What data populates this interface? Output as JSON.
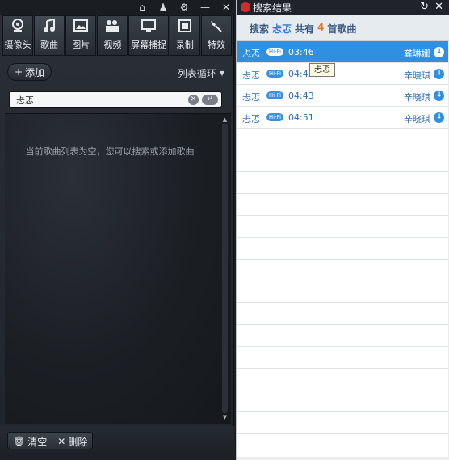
{
  "left": {
    "tabs": [
      {
        "label": "摄像头",
        "icon": "webcam-icon"
      },
      {
        "label": "歌曲",
        "icon": "music-note-icon"
      },
      {
        "label": "图片",
        "icon": "image-icon"
      },
      {
        "label": "视频",
        "icon": "video-icon"
      },
      {
        "label": "屏幕捕捉",
        "icon": "screen-capture-icon"
      },
      {
        "label": "录制",
        "icon": "record-icon"
      },
      {
        "label": "特效",
        "icon": "magic-wand-icon"
      }
    ],
    "add_label": "添加",
    "loop_mode": "列表循环",
    "search_value": "忐忑",
    "empty_message": "当前歌曲列表为空，您可以搜索或添加歌曲",
    "clear_label": "清空",
    "delete_label": "删除"
  },
  "right": {
    "title": "搜索结果",
    "header": {
      "prefix": "搜索",
      "keyword": "忐忑",
      "mid": "共有",
      "count": "4",
      "suffix": "首歌曲"
    },
    "results": [
      {
        "name": "忐忑",
        "badge": "Hi-Fi",
        "duration": "03:46",
        "artist": "龚琳娜",
        "selected": true
      },
      {
        "name": "忐忑",
        "badge": "Hi-Fi",
        "duration": "04:43",
        "artist": "辛晓琪",
        "selected": false
      },
      {
        "name": "忐忑",
        "badge": "Hi-Fi",
        "duration": "04:43",
        "artist": "辛晓琪",
        "selected": false
      },
      {
        "name": "忐忑",
        "badge": "Hi-Fi",
        "duration": "04:51",
        "artist": "辛晓琪",
        "selected": false
      }
    ],
    "tooltip": "忐忑"
  },
  "colors": {
    "accent": "#2f8fe0",
    "tab_underline": "#1d74c9",
    "count": "#e07a20"
  }
}
